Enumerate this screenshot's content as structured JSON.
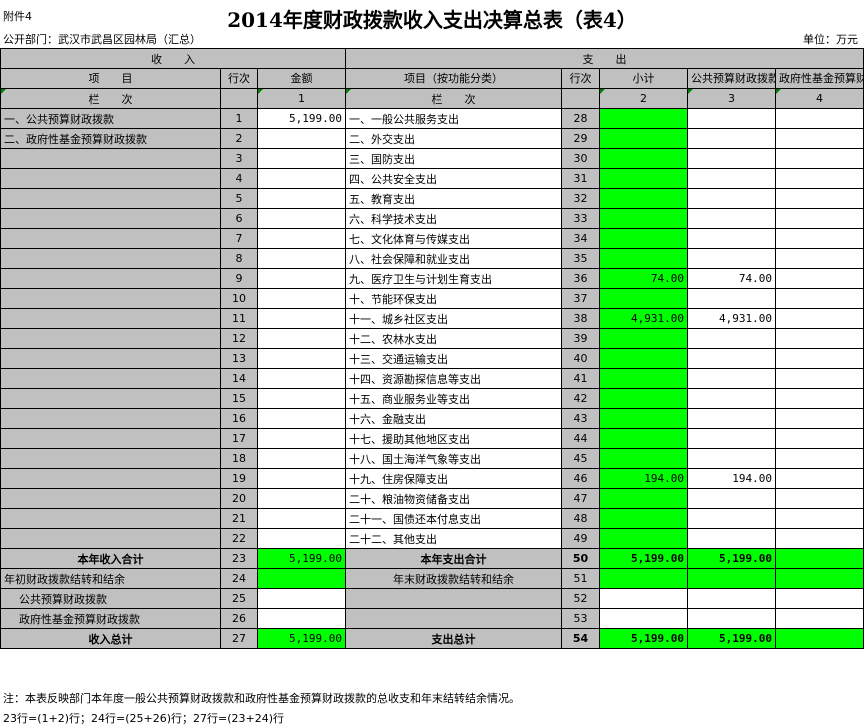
{
  "attachment": "附件4",
  "title": "2014年度财政拨款收入支出决算总表（表4）",
  "department": "公开部门：武汉市武昌区园林局（汇总）",
  "unit": "单位：万元",
  "headers": {
    "income": "收　　入",
    "expense": "支　　出",
    "item": "项　　目",
    "row_no": "行次",
    "amount": "金额",
    "item_func": "项目（按功能分类）",
    "subtotal": "小计",
    "public_budget": "公共预算财政拨款",
    "gov_fund": "政府性基金预算财政拨款",
    "column": "栏　　次",
    "col1": "1",
    "col2": "2",
    "col3": "3",
    "col4": "4"
  },
  "rows": [
    {
      "in_item": "一、公共预算财政拨款",
      "in_no": "1",
      "in_amt": "5,199.00",
      "ex_item": "一、一般公共服务支出",
      "ex_no": "28",
      "sub": "",
      "pub": ""
    },
    {
      "in_item": "二、政府性基金预算财政拨款",
      "in_no": "2",
      "in_amt": "",
      "ex_item": "二、外交支出",
      "ex_no": "29",
      "sub": "",
      "pub": ""
    },
    {
      "in_item": "",
      "in_no": "3",
      "in_amt": "",
      "ex_item": "三、国防支出",
      "ex_no": "30",
      "sub": "",
      "pub": ""
    },
    {
      "in_item": "",
      "in_no": "4",
      "in_amt": "",
      "ex_item": "四、公共安全支出",
      "ex_no": "31",
      "sub": "",
      "pub": ""
    },
    {
      "in_item": "",
      "in_no": "5",
      "in_amt": "",
      "ex_item": "五、教育支出",
      "ex_no": "32",
      "sub": "",
      "pub": ""
    },
    {
      "in_item": "",
      "in_no": "6",
      "in_amt": "",
      "ex_item": "六、科学技术支出",
      "ex_no": "33",
      "sub": "",
      "pub": ""
    },
    {
      "in_item": "",
      "in_no": "7",
      "in_amt": "",
      "ex_item": "七、文化体育与传媒支出",
      "ex_no": "34",
      "sub": "",
      "pub": ""
    },
    {
      "in_item": "",
      "in_no": "8",
      "in_amt": "",
      "ex_item": "八、社会保障和就业支出",
      "ex_no": "35",
      "sub": "",
      "pub": ""
    },
    {
      "in_item": "",
      "in_no": "9",
      "in_amt": "",
      "ex_item": "九、医疗卫生与计划生育支出",
      "ex_no": "36",
      "sub": "74.00",
      "pub": "74.00"
    },
    {
      "in_item": "",
      "in_no": "10",
      "in_amt": "",
      "ex_item": "十、节能环保支出",
      "ex_no": "37",
      "sub": "",
      "pub": ""
    },
    {
      "in_item": "",
      "in_no": "11",
      "in_amt": "",
      "ex_item": "十一、城乡社区支出",
      "ex_no": "38",
      "sub": "4,931.00",
      "pub": "4,931.00"
    },
    {
      "in_item": "",
      "in_no": "12",
      "in_amt": "",
      "ex_item": "十二、农林水支出",
      "ex_no": "39",
      "sub": "",
      "pub": ""
    },
    {
      "in_item": "",
      "in_no": "13",
      "in_amt": "",
      "ex_item": "十三、交通运输支出",
      "ex_no": "40",
      "sub": "",
      "pub": ""
    },
    {
      "in_item": "",
      "in_no": "14",
      "in_amt": "",
      "ex_item": "十四、资源勘探信息等支出",
      "ex_no": "41",
      "sub": "",
      "pub": ""
    },
    {
      "in_item": "",
      "in_no": "15",
      "in_amt": "",
      "ex_item": "十五、商业服务业等支出",
      "ex_no": "42",
      "sub": "",
      "pub": ""
    },
    {
      "in_item": "",
      "in_no": "16",
      "in_amt": "",
      "ex_item": "十六、金融支出",
      "ex_no": "43",
      "sub": "",
      "pub": ""
    },
    {
      "in_item": "",
      "in_no": "17",
      "in_amt": "",
      "ex_item": "十七、援助其他地区支出",
      "ex_no": "44",
      "sub": "",
      "pub": ""
    },
    {
      "in_item": "",
      "in_no": "18",
      "in_amt": "",
      "ex_item": "十八、国土海洋气象等支出",
      "ex_no": "45",
      "sub": "",
      "pub": ""
    },
    {
      "in_item": "",
      "in_no": "19",
      "in_amt": "",
      "ex_item": "十九、住房保障支出",
      "ex_no": "46",
      "sub": "194.00",
      "pub": "194.00"
    },
    {
      "in_item": "",
      "in_no": "20",
      "in_amt": "",
      "ex_item": "二十、粮油物资储备支出",
      "ex_no": "47",
      "sub": "",
      "pub": ""
    },
    {
      "in_item": "",
      "in_no": "21",
      "in_amt": "",
      "ex_item": "二十一、国债还本付息支出",
      "ex_no": "48",
      "sub": "",
      "pub": ""
    },
    {
      "in_item": "",
      "in_no": "22",
      "in_amt": "",
      "ex_item": "二十二、其他支出",
      "ex_no": "49",
      "sub": "",
      "pub": ""
    }
  ],
  "totals": {
    "year_income": {
      "label": "本年收入合计",
      "no": "23",
      "amt": "5,199.00"
    },
    "year_expense": {
      "label": "本年支出合计",
      "no": "50",
      "sub": "5,199.00",
      "pub": "5,199.00"
    },
    "carry_in": {
      "label": "年初财政拨款结转和结余",
      "no": "24"
    },
    "carry_out": {
      "label": "年末财政拨款结转和结余",
      "no": "51"
    },
    "pub_budget": {
      "label": "公共预算财政拨款",
      "no": "25",
      "ex_no": "52"
    },
    "gov_fund": {
      "label": "政府性基金预算财政拨款",
      "no": "26",
      "ex_no": "53"
    },
    "income_total": {
      "label": "收入总计",
      "no": "27",
      "amt": "5,199.00"
    },
    "expense_total": {
      "label": "支出总计",
      "no": "54",
      "sub": "5,199.00",
      "pub": "5,199.00"
    }
  },
  "note1": "注：本表反映部门本年度一般公共预算财政拨款和政府性基金预算财政拨款的总收支和年末结转结余情况。",
  "note2": "23行=(1+2)行；24行=(25+26)行；27行=(23+24)行"
}
